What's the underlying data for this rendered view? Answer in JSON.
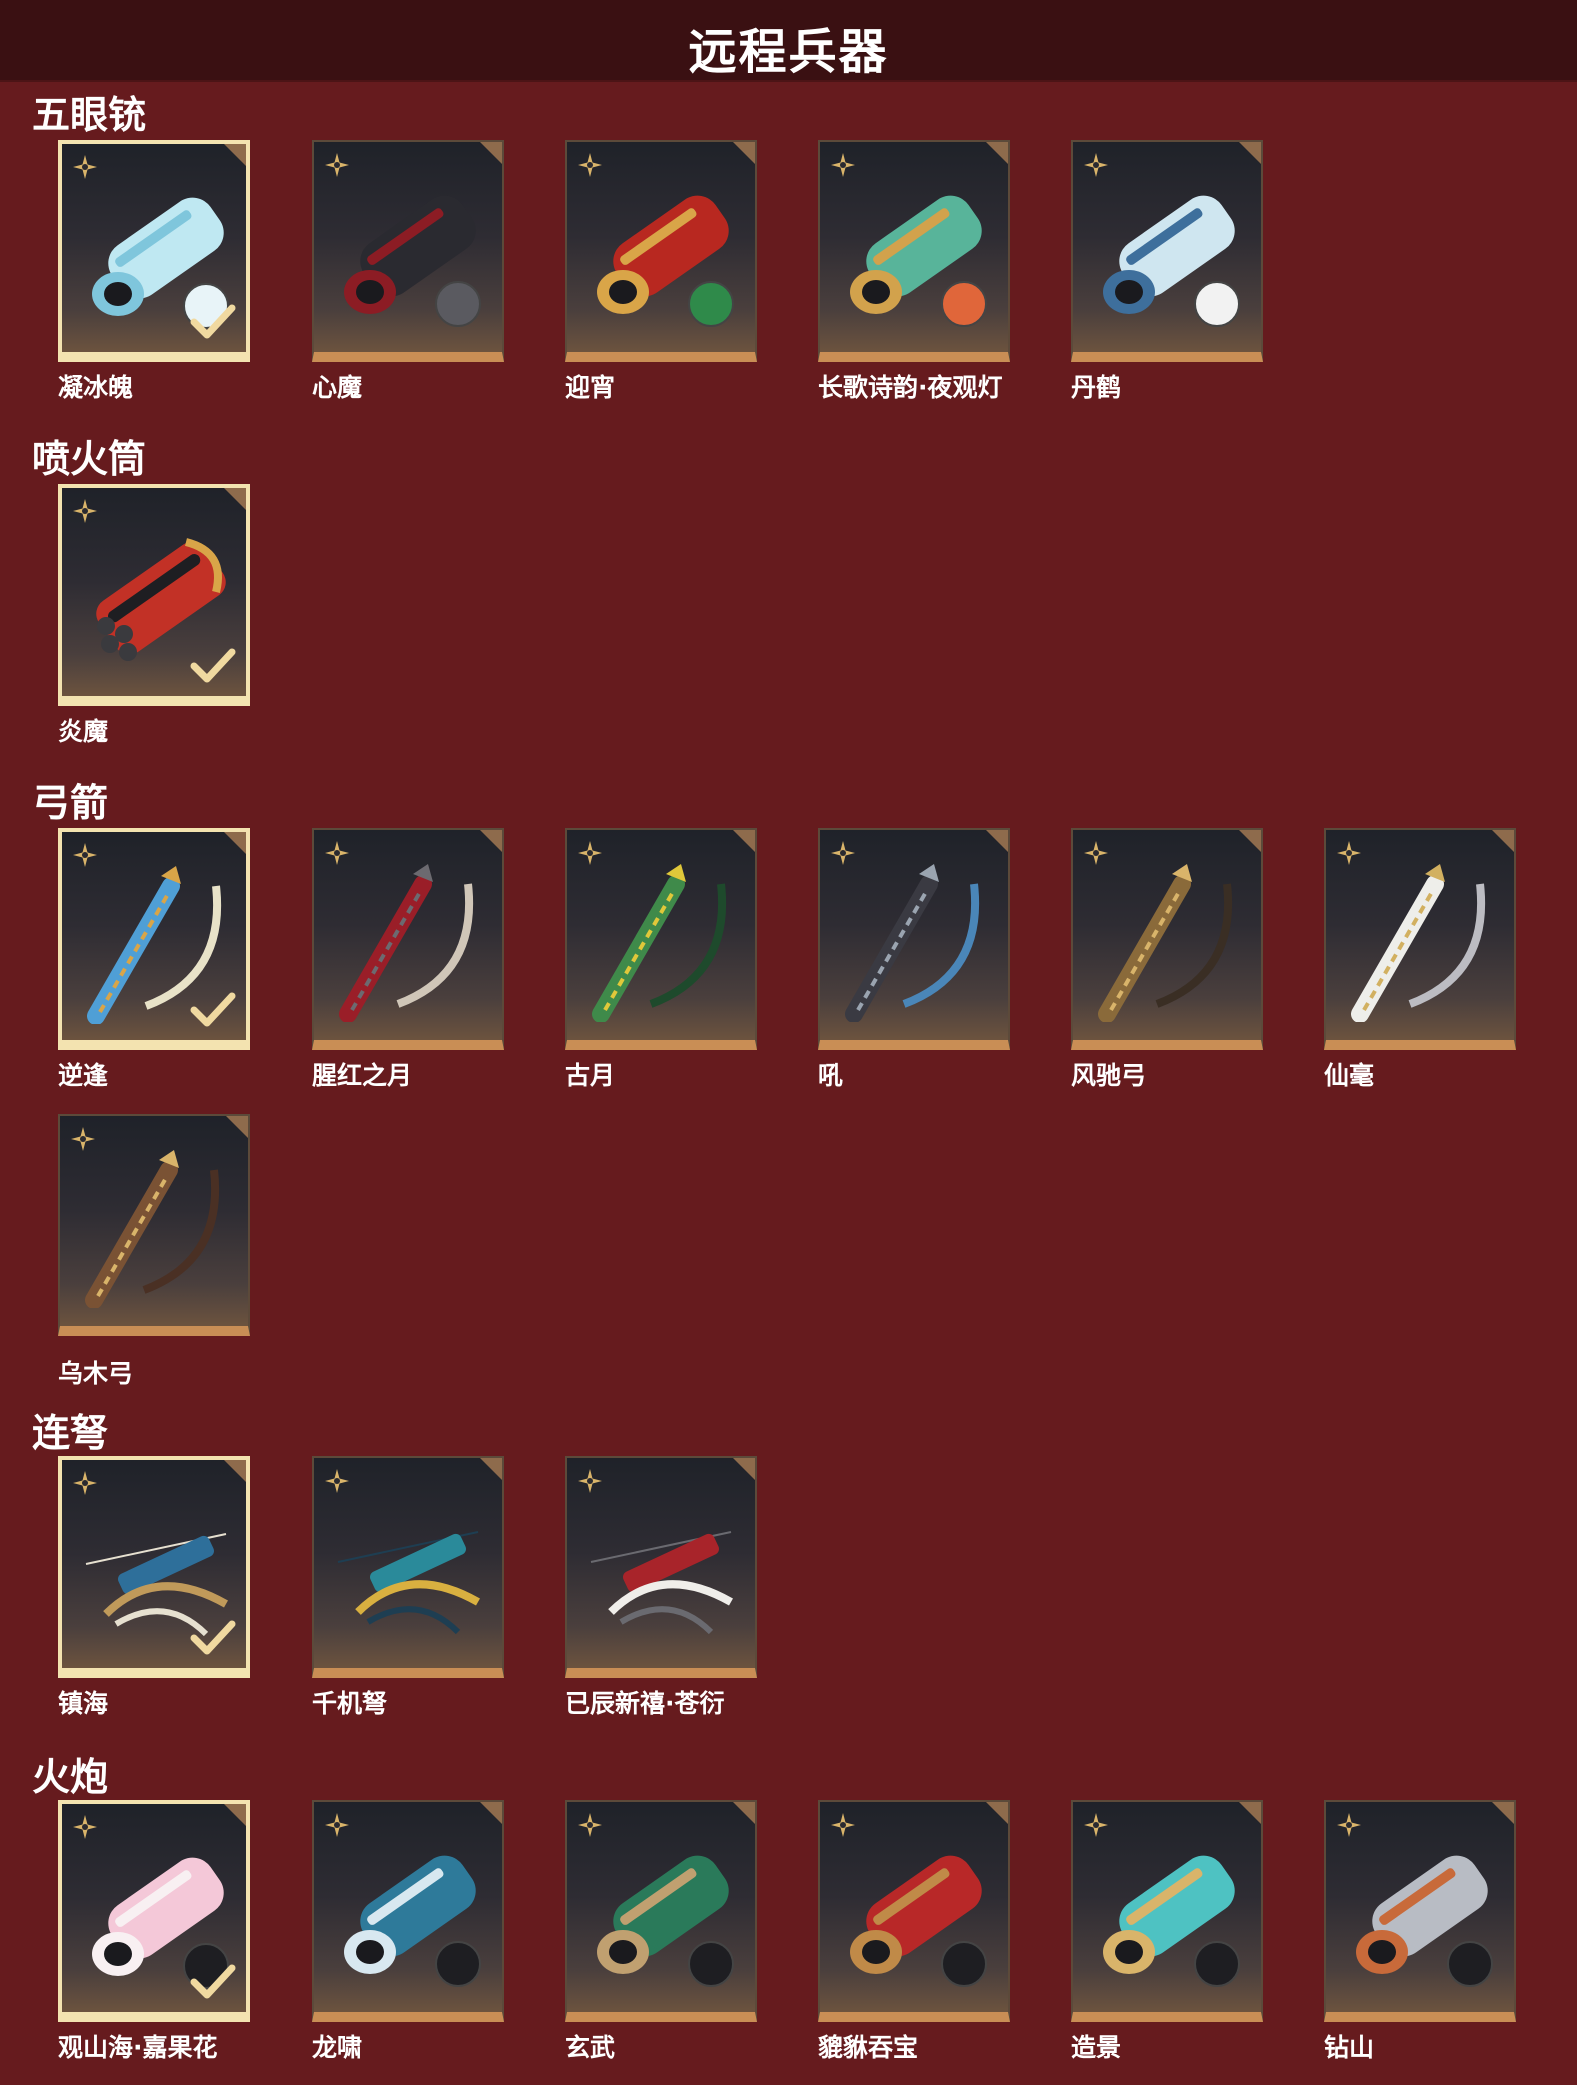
{
  "page": {
    "title": "远程兵器",
    "colors": {
      "background": "#661b1e",
      "header": "#3a1012",
      "card_base": "#c98e55",
      "selected_border": "#f3e3b0",
      "star": "#d9b46a"
    }
  },
  "sections": [
    {
      "title": "五眼铳",
      "items": [
        {
          "name": "凝冰魄",
          "selected": true,
          "icon": "ice-handcannon"
        },
        {
          "name": "心魔",
          "selected": false,
          "icon": "dark-red-handcannon"
        },
        {
          "name": "迎宵",
          "selected": false,
          "icon": "red-gold-handcannon"
        },
        {
          "name": "长歌诗韵·夜观灯",
          "selected": false,
          "icon": "jade-fish-handcannon"
        },
        {
          "name": "丹鹤",
          "selected": false,
          "icon": "blue-white-handcannon"
        }
      ]
    },
    {
      "title": "喷火筒",
      "items": [
        {
          "name": "炎魔",
          "selected": true,
          "icon": "red-flamethrower"
        }
      ]
    },
    {
      "title": "弓箭",
      "items": [
        {
          "name": "逆逢",
          "selected": true,
          "icon": "blue-gold-bow"
        },
        {
          "name": "腥红之月",
          "selected": false,
          "icon": "crimson-bow"
        },
        {
          "name": "古月",
          "selected": false,
          "icon": "green-jade-bow"
        },
        {
          "name": "吼",
          "selected": false,
          "icon": "dark-silver-bow"
        },
        {
          "name": "风驰弓",
          "selected": false,
          "icon": "bronze-bow"
        },
        {
          "name": "仙毫",
          "selected": false,
          "icon": "white-gold-bow"
        },
        {
          "name": "乌木弓",
          "selected": false,
          "icon": "wooden-bow"
        }
      ]
    },
    {
      "title": "连弩",
      "items": [
        {
          "name": "镇海",
          "selected": true,
          "icon": "blue-crossbow"
        },
        {
          "name": "千机弩",
          "selected": false,
          "icon": "teal-crossbow"
        },
        {
          "name": "已辰新禧·苍衍",
          "selected": false,
          "icon": "red-white-crossbow"
        }
      ]
    },
    {
      "title": "火炮",
      "items": [
        {
          "name": "观山海·嘉果花",
          "selected": true,
          "icon": "pink-flower-cannon"
        },
        {
          "name": "龙啸",
          "selected": false,
          "icon": "dragon-cannon"
        },
        {
          "name": "玄武",
          "selected": false,
          "icon": "green-serpent-cannon"
        },
        {
          "name": "貔貅吞宝",
          "selected": false,
          "icon": "red-pixiu-cannon"
        },
        {
          "name": "造景",
          "selected": false,
          "icon": "turquoise-cannon"
        },
        {
          "name": "钻山",
          "selected": false,
          "icon": "silver-drill-cannon"
        }
      ]
    }
  ]
}
